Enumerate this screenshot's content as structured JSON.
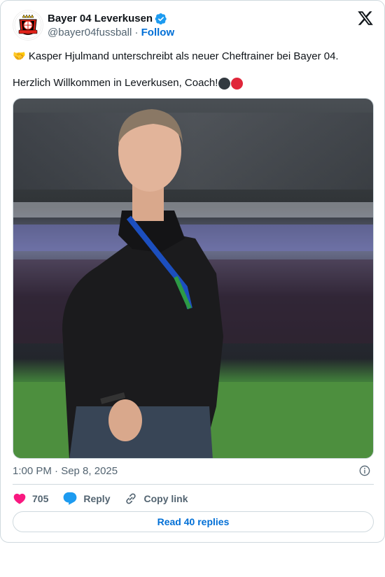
{
  "author": {
    "display_name": "Bayer 04 Leverkusen",
    "handle": "@bayer04fussball",
    "separator": " · ",
    "follow_label": "Follow",
    "logo_text": "BAYER 04 LEVERKUSEN"
  },
  "tweet": {
    "line1_emoji": "🤝",
    "line1": " Kasper Hjulmand unterschreibt als neuer Cheftrainer bei Bayer 04.",
    "line2": "Herzlich Willkommen in Leverkusen, Coach! ",
    "timestamp": "1:00 PM · Sep 8, 2025"
  },
  "actions": {
    "likes_count": "705",
    "reply_label": "Reply",
    "copy_link_label": "Copy link",
    "read_replies_label": "Read 40 replies"
  },
  "colors": {
    "brand_blue": "#006fd6",
    "like_pink": "#f91880",
    "reply_blue": "#1d9bf0",
    "dot_black": "#333a40",
    "dot_red": "#e0263a",
    "verified_blue": "#1d9bf0"
  },
  "icons": [
    "verified-badge-icon",
    "x-logo-icon",
    "info-icon",
    "heart-icon",
    "reply-bubble-icon",
    "link-icon"
  ]
}
